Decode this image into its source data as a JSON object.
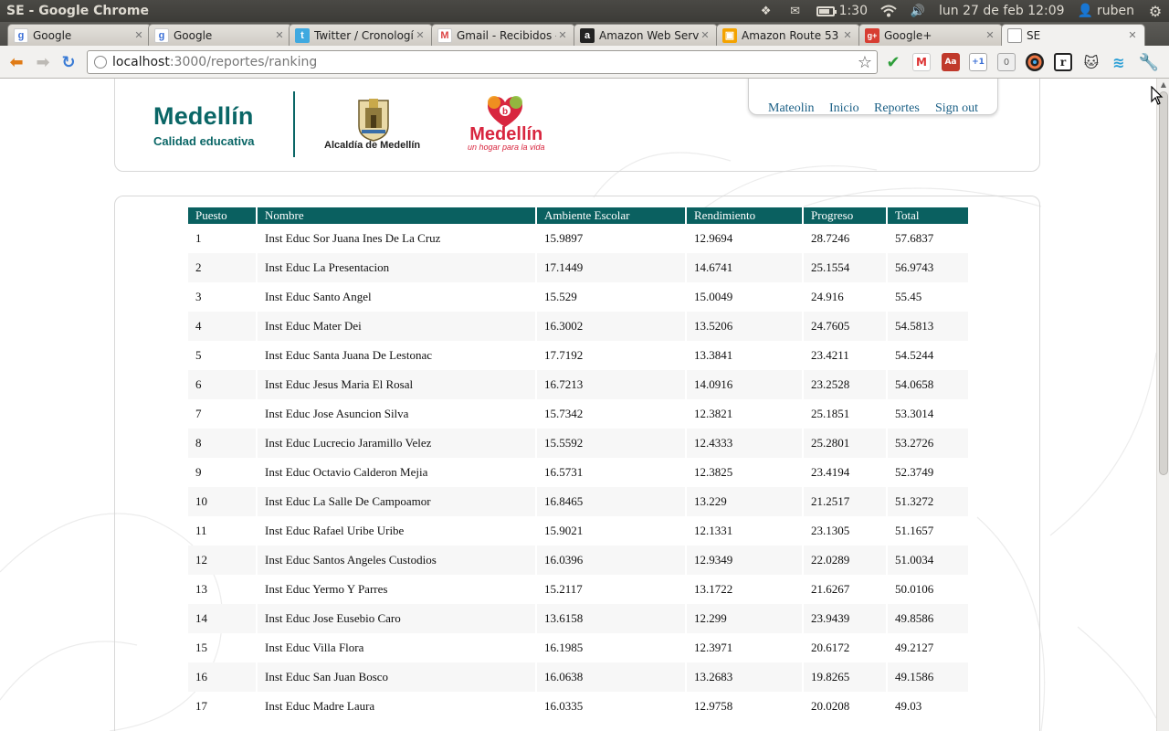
{
  "os": {
    "window_title": "SE - Google Chrome",
    "battery_time": "1:30",
    "datetime": "lun 27 de feb 12:09",
    "user": "ruben",
    "battery_level": 0.75
  },
  "tabs": [
    {
      "label": "Google",
      "icon": "google-icon",
      "close": "✕"
    },
    {
      "label": "Google",
      "icon": "google-icon",
      "close": "✕"
    },
    {
      "label": "Twitter / Cronología",
      "icon": "twitter-icon",
      "close": "✕"
    },
    {
      "label": "Gmail - Recibidos - r",
      "icon": "gmail-icon",
      "close": "✕"
    },
    {
      "label": "Amazon Web Servic",
      "icon": "amazon-icon",
      "close": "✕"
    },
    {
      "label": "Amazon Route 53",
      "icon": "route53-icon",
      "close": "✕"
    },
    {
      "label": "Google+",
      "icon": "googleplus-icon",
      "close": "✕"
    },
    {
      "label": "SE",
      "icon": "page-icon",
      "close": "✕"
    }
  ],
  "omnibox": {
    "host": "localhost",
    "path": ":3000/reportes/ranking"
  },
  "extensions": {
    "counter_badge": "0",
    "plus_one": "+1",
    "reader": "r",
    "dictionary": "Aa"
  },
  "header": {
    "logo_title": "Medellín",
    "logo_subtitle": "Calidad educativa",
    "alcaldia": "Alcaldía de Medellín",
    "brand_name": "Medellín",
    "brand_tagline": "un hogar para la vida"
  },
  "nav": {
    "items": [
      "Mateolin",
      "Inicio",
      "Reportes",
      "Sign out"
    ]
  },
  "table": {
    "headers": [
      "Puesto",
      "Nombre",
      "Ambiente Escolar",
      "Rendimiento",
      "Progreso",
      "Total"
    ],
    "rows": [
      [
        "1",
        "Inst Educ Sor Juana Ines De La Cruz",
        "15.9897",
        "12.9694",
        "28.7246",
        "57.6837"
      ],
      [
        "2",
        "Inst Educ La Presentacion",
        "17.1449",
        "14.6741",
        "25.1554",
        "56.9743"
      ],
      [
        "3",
        "Inst Educ Santo Angel",
        "15.529",
        "15.0049",
        "24.916",
        "55.45"
      ],
      [
        "4",
        "Inst Educ Mater Dei",
        "16.3002",
        "13.5206",
        "24.7605",
        "54.5813"
      ],
      [
        "5",
        "Inst Educ Santa Juana De Lestonac",
        "17.7192",
        "13.3841",
        "23.4211",
        "54.5244"
      ],
      [
        "6",
        "Inst Educ Jesus Maria El Rosal",
        "16.7213",
        "14.0916",
        "23.2528",
        "54.0658"
      ],
      [
        "7",
        "Inst Educ Jose Asuncion Silva",
        "15.7342",
        "12.3821",
        "25.1851",
        "53.3014"
      ],
      [
        "8",
        "Inst Educ Lucrecio Jaramillo Velez",
        "15.5592",
        "12.4333",
        "25.2801",
        "53.2726"
      ],
      [
        "9",
        "Inst Educ Octavio Calderon Mejia",
        "16.5731",
        "12.3825",
        "23.4194",
        "52.3749"
      ],
      [
        "10",
        "Inst Educ La Salle De Campoamor",
        "16.8465",
        "13.229",
        "21.2517",
        "51.3272"
      ],
      [
        "11",
        "Inst Educ Rafael Uribe Uribe",
        "15.9021",
        "12.1331",
        "23.1305",
        "51.1657"
      ],
      [
        "12",
        "Inst Educ Santos Angeles Custodios",
        "16.0396",
        "12.9349",
        "22.0289",
        "51.0034"
      ],
      [
        "13",
        "Inst Educ Yermo Y Parres",
        "15.2117",
        "13.1722",
        "21.6267",
        "50.0106"
      ],
      [
        "14",
        "Inst Educ Jose Eusebio Caro",
        "13.6158",
        "12.299",
        "23.9439",
        "49.8586"
      ],
      [
        "15",
        "Inst Educ Villa Flora",
        "16.1985",
        "12.3971",
        "20.6172",
        "49.2127"
      ],
      [
        "16",
        "Inst Educ San Juan Bosco",
        "16.0638",
        "13.2683",
        "19.8265",
        "49.1586"
      ],
      [
        "17",
        "Inst Educ Madre Laura",
        "16.0335",
        "12.9758",
        "20.0208",
        "49.03"
      ]
    ]
  },
  "colors": {
    "accent": "#0a6060",
    "link": "#1a5f85",
    "brand_red": "#d8263f"
  }
}
